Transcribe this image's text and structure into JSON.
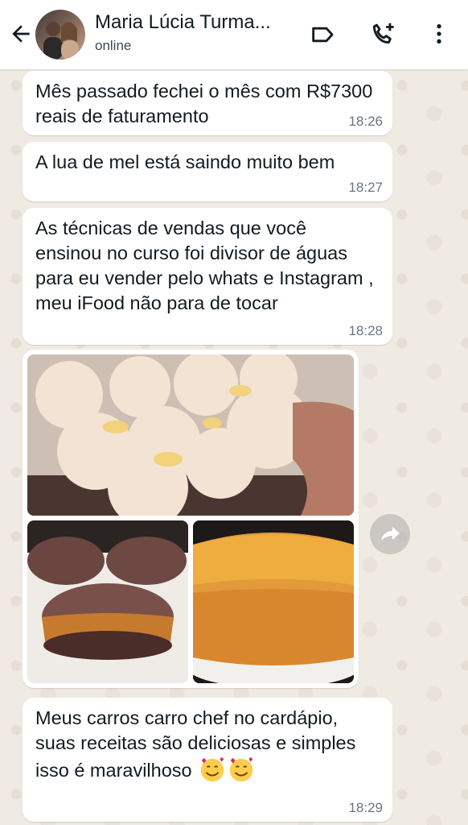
{
  "header": {
    "contact_name": "Maria Lúcia Turma...",
    "status": "online",
    "icons": [
      "back-arrow-icon",
      "avatar",
      "label-icon",
      "add-call-icon",
      "more-vert-icon"
    ]
  },
  "messages": [
    {
      "text": "Mês passado fechei o mês com R$7300 reais de faturamento",
      "time": "18:26"
    },
    {
      "text": "A lua de mel está saindo muito bem",
      "time": "18:27"
    },
    {
      "text": "As técnicas de vendas que você ensinou no curso foi divisor de águas para eu vender pelo whats e Instagram , meu iFood não para de tocar",
      "time": "18:28"
    },
    {
      "text": "Meus carros carro chef no cardápio, suas receitas são deliciosas e simples isso é maravilhoso",
      "time": "18:29"
    }
  ],
  "media": {
    "images": [
      "coconut-sweets-photo",
      "chocolate-sandwich-cookies-photo",
      "bundt-cake-photo"
    ],
    "forward_icon": "forward-icon"
  },
  "colors": {
    "chat_background": "#efeae2",
    "bubble": "#ffffff",
    "time_text": "#667781",
    "header": "#ffffff"
  }
}
